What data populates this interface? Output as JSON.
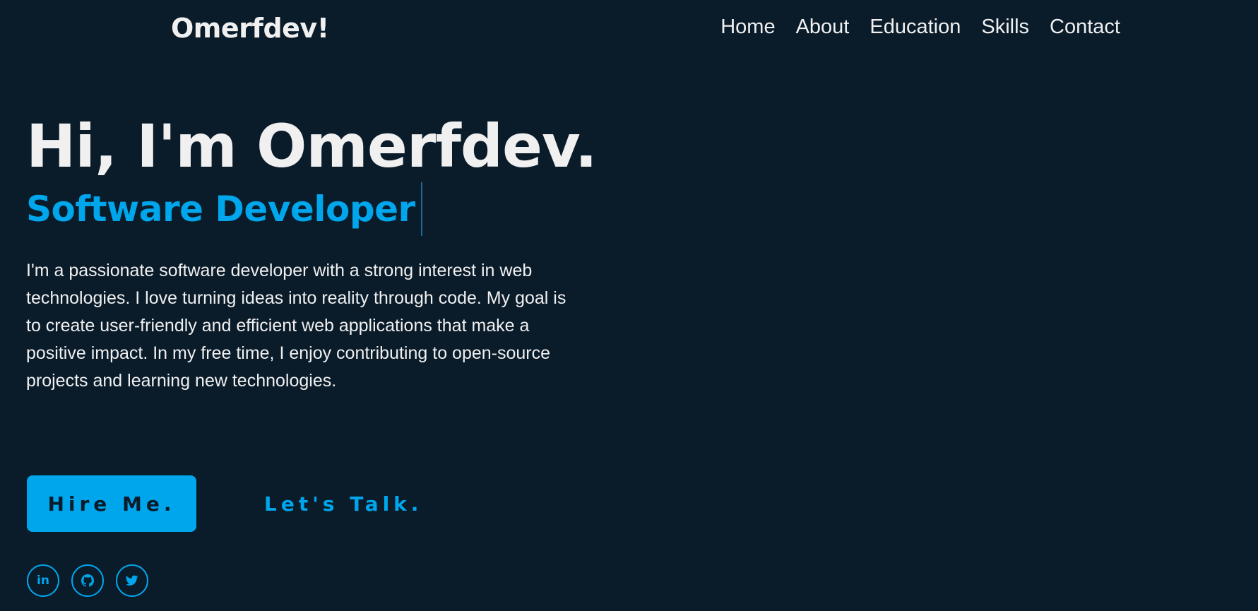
{
  "header": {
    "logo": "Omerfdev!",
    "nav": [
      "Home",
      "About",
      "Education",
      "Skills",
      "Contact"
    ]
  },
  "hero": {
    "headline": "Hi, I'm Omerfdev.",
    "role": "Software Developer",
    "bio": "I'm a passionate software developer with a strong interest in web technologies. I love turning ideas into reality through code. My goal is to create user-friendly and efficient web applications that make a positive impact. In my free time, I enjoy contributing to open-source projects and learning new technologies.",
    "primary_button": "Hire Me.",
    "secondary_button": "Let's Talk."
  },
  "socials": {
    "linkedin_text": "in",
    "icons": [
      "linkedin-icon",
      "github-icon",
      "twitter-icon"
    ]
  },
  "colors": {
    "background": "#0a1b2a",
    "accent": "#00a6ec",
    "text": "#f0f0f0"
  }
}
